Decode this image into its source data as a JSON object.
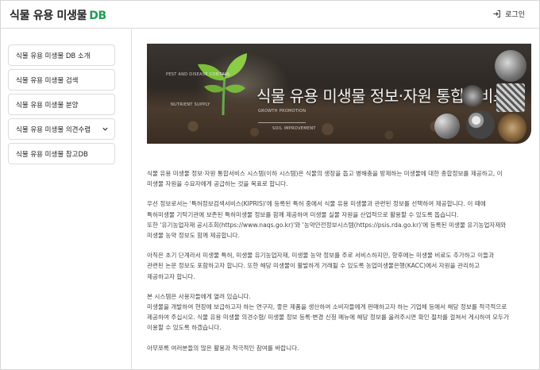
{
  "header": {
    "title_main": "식물 유용 미생물",
    "title_accent": "DB",
    "login_label": "로그인"
  },
  "sidebar": {
    "items": [
      {
        "label": "식물 유용 미생물 DB 소개",
        "has_chevron": false
      },
      {
        "label": "식물 유용 미생물 검색",
        "has_chevron": false
      },
      {
        "label": "식물 유용 미생물 분양",
        "has_chevron": false
      },
      {
        "label": "식물 유용 미생물 의견수렴",
        "has_chevron": true
      },
      {
        "label": "식물 유용 미생물 참고DB",
        "has_chevron": false
      }
    ]
  },
  "banner": {
    "title": "식물 유용 미생물 정보·자원 통합서비스",
    "tags": [
      "PEST AND DISEASE CONTROL",
      "NUTRIENT SUPPLY",
      "GROWTH PROMOTION",
      "SOIL IMPROVEMENT"
    ]
  },
  "content": {
    "paragraphs": [
      "식물 유용 미생물 정보·자원 통합서비스 시스템(이하 시스템)은 식물의 생장을 돕고 병해충을 방제하는 미생물에 대한 종합정보를 제공하고, 이\n미생물 자원을 수요자에게 공급하는 것을 목표로 합니다.",
      "우선 정보로서는 '특허정보검색서비스(KIPRIS)'에 등록된 특허 중에서 식물 유용 미생물과 관련된 정보를 선택하여 제공합니다. 이 때에\n특허미생물 기탁기관에 보존된 특허미생물 정보를 함께 제공하여 미생물 실물 자원을 산업적으로 활용할 수 있도록 돕습니다.\n또한 '유기농업자재 공시조회(https://www.naqs.go.kr)'와 '농약안전정보시스템(https://psis.rda.go.kr)'에 등록된 미생물 유기농업자재와\n미생물 농약 정보도 함께 제공합니다.",
      "아직은 초기 단계라서 미생물 특허, 미생물 유기농업자재, 미생물 농약 정보를 주로 서비스하지만, 향후에는 미생물 비료도 추가하고 이들과\n관련된 논문 정보도 포함하고자 합니다. 또한 해당 미생물이 활발하게 거래될 수 있도록 농업미생물은행(KACC)에서 자원을 관리하고\n제공하고자 합니다.",
      "본 시스템은 사용자들에게 열려 있습니다.\n미생물을 개발하여 현장에 보급하고자 하는 연구자, 좋은 제품을 생산하여 소비자들에게 판매하고자 하는 기업체 등에서 해당 정보를 적극적으로\n제공하여 주십시오. 식물 유용 미생물 의견수렴/ 미생물 정보 등록·변경 신청 메뉴에 해당 정보를 올려주시면 확인 절차를 걸쳐서 게시하여 모두가\n이용할 수 있도록 하겠습니다.",
      "아무쪼록 여러분들의 많은 활용과 적극적인 참여를 바랍니다."
    ]
  },
  "colors": {
    "accent": "#1f9d55",
    "border": "#dcdcdc",
    "text": "#444444"
  }
}
